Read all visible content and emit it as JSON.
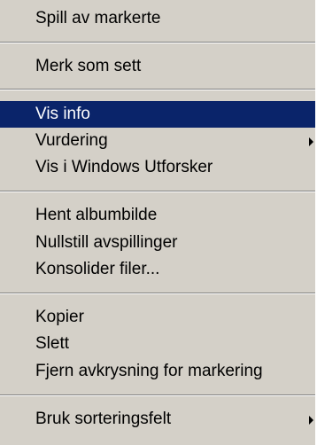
{
  "menu": {
    "items": [
      {
        "label": "Spill av markerte"
      },
      {
        "label": "Merk som sett"
      },
      {
        "label": "Vis info",
        "selected": true
      },
      {
        "label": "Vurdering",
        "submenu": true
      },
      {
        "label": "Vis i Windows Utforsker"
      },
      {
        "label": "Hent albumbilde"
      },
      {
        "label": "Nullstill avspillinger"
      },
      {
        "label": "Konsolider filer..."
      },
      {
        "label": "Kopier"
      },
      {
        "label": "Slett"
      },
      {
        "label": "Fjern avkrysning for markering"
      },
      {
        "label": "Bruk sorteringsfelt",
        "submenu": true
      }
    ],
    "colors": {
      "background": "#d4d0c8",
      "highlight": "#0a246a",
      "highlight_text": "#ffffff"
    }
  }
}
